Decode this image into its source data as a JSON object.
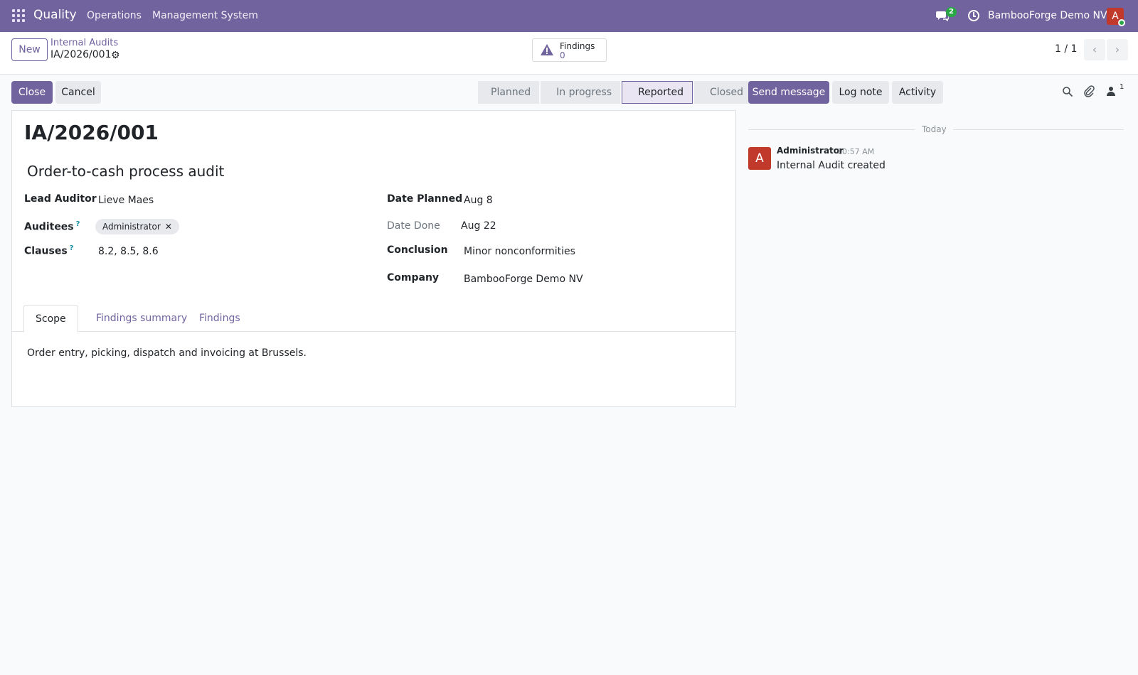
{
  "navbar": {
    "app_name": "Quality",
    "menu": [
      "Operations",
      "Management System"
    ],
    "chat_badge": "2",
    "company": "BambooForge Demo NV",
    "avatar_letter": "A",
    "bg_color": "#71639e"
  },
  "control": {
    "new_label": "New",
    "breadcrumb_parent": "Internal Audits",
    "breadcrumb_current": "IA/2026/001",
    "smart_button": {
      "label": "Findings",
      "value": "0"
    },
    "pager": "1 / 1"
  },
  "actions": {
    "close_label": "Close",
    "cancel_label": "Cancel"
  },
  "statusbar": {
    "stages": [
      "Planned",
      "In progress",
      "Reported",
      "Closed"
    ],
    "active": "Reported"
  },
  "form": {
    "name": "IA/2026/001",
    "title": "Order-to-cash process audit",
    "lead_auditor_label": "Lead Auditor",
    "lead_auditor": "Lieve Maes",
    "auditees_label": "Auditees",
    "auditee_tag": "Administrator",
    "clauses_label": "Clauses",
    "clauses": "8.2, 8.5, 8.6",
    "date_planned_label": "Date Planned",
    "date_planned": "Aug 8",
    "date_done_label": "Date Done",
    "date_done": "Aug 22",
    "conclusion_label": "Conclusion",
    "conclusion": "Minor nonconformities",
    "company_label": "Company",
    "company": "BambooForge Demo NV",
    "help_mark": "?"
  },
  "tabs": {
    "items": [
      "Scope",
      "Findings summary",
      "Findings"
    ],
    "active": "Scope",
    "scope_text": "Order entry, picking, dispatch and invoicing at Brussels."
  },
  "chatter": {
    "send_label": "Send message",
    "log_label": "Log note",
    "activity_label": "Activity",
    "followers_count": "1",
    "separator": "Today",
    "message": {
      "avatar_letter": "A",
      "author": "Administrator",
      "time": "10:57 AM",
      "body": "Internal Audit created"
    }
  }
}
